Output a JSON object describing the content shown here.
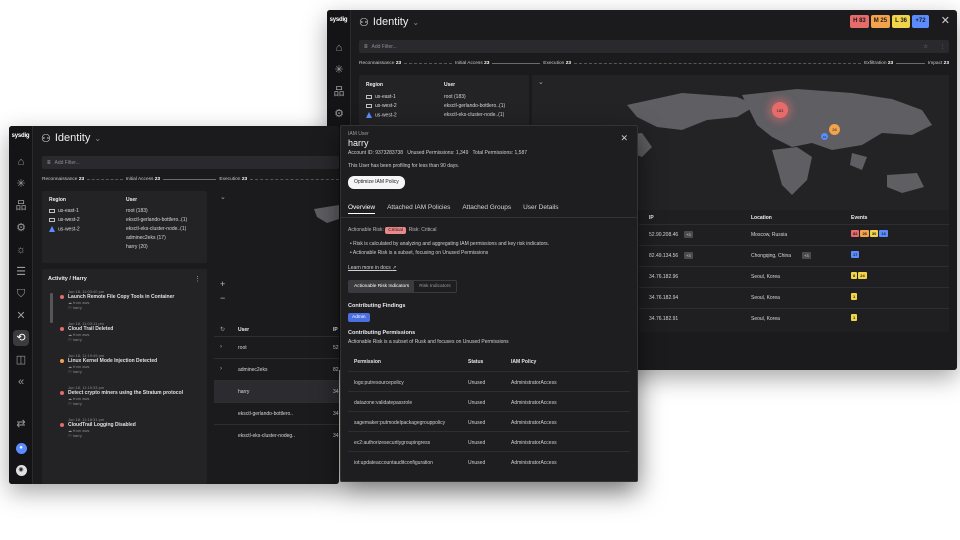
{
  "app_logo": "sysdig",
  "header_title": "Identity",
  "filter_placeholder": "Add Filter...",
  "badges": [
    {
      "label": "H 83",
      "color": "#e86b6b"
    },
    {
      "label": "M 25",
      "color": "#f2a34b"
    },
    {
      "label": "L 36",
      "color": "#f2d44b"
    },
    {
      "label": "+72",
      "color": "#5b8cff"
    }
  ],
  "stages_a": {
    "recon": "Reconnaissance",
    "recon_n": "23",
    "initial": "Initial Access",
    "initial_n": "23",
    "exec": "Execution",
    "exec_n": "23",
    "exfil": "Exfiltration",
    "exfil_n": "23",
    "impact": "Impact",
    "impact_n": "23"
  },
  "stages_b": {
    "recon": "Reconnaissance",
    "recon_n": "23",
    "initial": "Initial Access",
    "initial_n": "23",
    "exec": "Execution",
    "exec_n": "23"
  },
  "region_table": {
    "h_region": "Region",
    "h_user": "User",
    "regions": [
      "us-east-1",
      "us-west-2",
      "us-west-2"
    ],
    "users_a": [
      "root (183)",
      "eksctl-gerlando-bottlero..(1)",
      "eksctl-eks-cluster-node..(1)"
    ],
    "users_b": [
      "root (183)",
      "eksctl-gerlando-bottlero..(1)",
      "eksctl-eks-cluster-node..(1)",
      "adminec2eks (17)",
      "harry (20)"
    ]
  },
  "ip_table": {
    "h_ip": "IP",
    "h_location": "Location",
    "h_events": "Events",
    "rows": [
      {
        "ip": "52.90.208.46",
        "more": "+3",
        "loc": "Moscow, Russia",
        "loc_more": ""
      },
      {
        "ip": "82.49.134.56",
        "more": "+3",
        "loc": "Chongqing, China",
        "loc_more": "+3"
      },
      {
        "ip": "34.76.182.96",
        "more": "",
        "loc": "Seoul, Korea",
        "loc_more": ""
      },
      {
        "ip": "34.76.182.94",
        "more": "",
        "loc": "Seoul, Korea",
        "loc_more": ""
      },
      {
        "ip": "34.76.182.91",
        "more": "",
        "loc": "Seoul, Korea",
        "loc_more": ""
      }
    ],
    "event_chips": [
      [
        {
          "t": "82",
          "c": "#e86b6b"
        },
        {
          "t": "26",
          "c": "#f2a34b"
        },
        {
          "t": "30",
          "c": "#f2d44b"
        },
        {
          "t": "16",
          "c": "#5b8cff"
        }
      ],
      [
        {
          "t": "17",
          "c": "#5b8cff"
        }
      ],
      [
        {
          "t": "8",
          "c": "#f2d44b"
        },
        {
          "t": "24",
          "c": "#f2d44b"
        }
      ],
      [
        {
          "t": "1",
          "c": "#f2d44b"
        }
      ],
      [
        {
          "t": "1",
          "c": "#f2d44b"
        }
      ]
    ]
  },
  "map_markers": [
    {
      "t": "183",
      "c": "#e86b6b"
    },
    {
      "t": "26",
      "c": "#f2a34b"
    },
    {
      "t": "16",
      "c": "#5b8cff"
    }
  ],
  "user_list": {
    "h_user": "User",
    "h_ip": "IP",
    "rows": [
      "root",
      "adminec2eks",
      "harry",
      "eksctl-gerlando-bottlero..",
      "eksctl-eks-cluster-nodeg.."
    ],
    "ips": [
      "52.",
      "82.",
      "34.",
      "34.",
      "34."
    ]
  },
  "activity": {
    "title": "Activity / Harry",
    "items": [
      {
        "time": "Jun 18, 11:03:40 pm",
        "name": "Launch Remote File Copy Tools in Container",
        "src": "from aws",
        "user": "harry",
        "color": "#e86b6b"
      },
      {
        "time": "Jun 18, 11:03:11 pm",
        "name": "Cloud Trail Deleted",
        "src": "from aws",
        "user": "harry",
        "color": "#e86b6b"
      },
      {
        "time": "Jun 18, 11:19:49 pm",
        "name": "Linux Kernel Mode Injection Detected",
        "src": "from aws",
        "user": "harry",
        "color": "#f2a34b"
      },
      {
        "time": "Jun 18, 11:19:33 pm",
        "name": "Detect crypto miners using the Stratum protocol",
        "src": "from aws",
        "user": "harry",
        "color": "#e86b6b"
      },
      {
        "time": "Jun 18, 11:18:31 pm",
        "name": "CloudTrail Logging Disabled",
        "src": "from aws",
        "user": "harry",
        "color": "#e86b6b"
      }
    ]
  },
  "modal": {
    "type_label": "IAM User",
    "name": "harry",
    "account": "Account ID: 9373283738",
    "unused": "Unused Permissions: 1,349",
    "total": "Total Permissions: 1,587",
    "profiling": "This User has been profiling for less than 90 days.",
    "optimize_btn": "Optimize IAM Policy",
    "tabs": [
      "Overview",
      "Attached IAM Policies",
      "Attached Groups",
      "User Details"
    ],
    "ar_label": "Actionable Risk:",
    "ar_value": "Critical",
    "risk_label": "Risk:",
    "risk_value": "Critical",
    "bullet1": "Risk is calculated by analyzing and aggregating IAM permissions and key risk indicators.",
    "bullet2": "Actionable Risk is a subset, focusing on Unused Permissions",
    "learn_more": "Learn more in docs",
    "seg": [
      "Actionable Risk Indicators",
      "Risk Indicators"
    ],
    "cf_title": "Contributing Findings",
    "cf_tag": "Admin",
    "cp_title": "Contributing Permissions",
    "cp_sub": "Actionable Risk is a subset of Rusk and focuses on Unused Permissions",
    "h_perm": "Permission",
    "h_status": "Status",
    "h_policy": "IAM Policy",
    "perms": [
      {
        "p": "logs:putresourcepolicy",
        "s": "Unused",
        "a": "AdministratorAccess"
      },
      {
        "p": "datazone:validatepassrole",
        "s": "Unused",
        "a": "AdministratorAccess"
      },
      {
        "p": "sagemaker:putmodelpackagegrouppolicy",
        "s": "Unused",
        "a": "AdministratorAccess"
      },
      {
        "p": "ec2:authorizesecuritygroupingress",
        "s": "Unused",
        "a": "AdministratorAccess"
      },
      {
        "p": "iot:updateaccountauditconfiguration",
        "s": "Unused",
        "a": "AdministratorAccess"
      }
    ]
  }
}
